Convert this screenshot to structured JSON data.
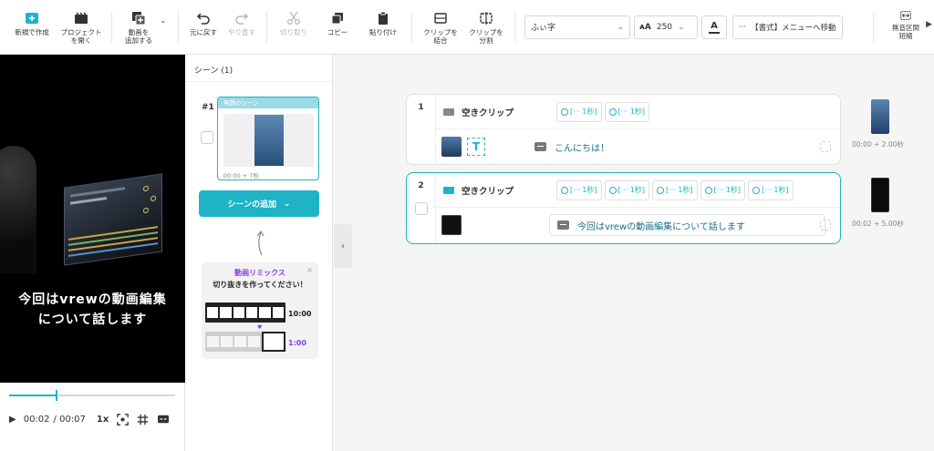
{
  "toolbar": {
    "new": "新規で作成",
    "open": "プロジェクト\nを開く",
    "add_video": "動画を\n追加する",
    "undo": "元に戻す",
    "redo": "やり直す",
    "cut": "切り取り",
    "copy": "コピー",
    "paste": "貼り付け",
    "merge": "クリップを\n結合",
    "split": "クリップを\n分割",
    "font": "ふぃ字",
    "font_size": "250",
    "size_icon": "ᴀA",
    "color_label": "A",
    "format_menu": "【書式】メニューへ移動",
    "more": "···",
    "silence": "無音区間\n短縮"
  },
  "player": {
    "caption_line1": "今回はvrewの動画編集",
    "caption_line2": "について話します",
    "current_time": "00:02",
    "total_time": "/ 00:07",
    "speed": "1x",
    "progress": 0.28
  },
  "scenes": {
    "title": "シーン (1)",
    "items": [
      {
        "num": "#1",
        "label": "無題のシーン",
        "duration": "00:00 + 7秒"
      }
    ],
    "add_label": "シーンの追加",
    "remix_title": "動画リミックス",
    "remix_sub": "切り抜きを作ってください！",
    "remix_time1": "10:00",
    "remix_time2": "1:00",
    "close": "×"
  },
  "clips": [
    {
      "num": "1",
      "name": "空きクリップ",
      "chips": [
        "[··· 1秒]",
        "[··· 1秒]"
      ],
      "text": "こんにちは！",
      "side_time": "00:00 + 2.00秒"
    },
    {
      "num": "2",
      "name": "空きクリップ",
      "chips": [
        "[··· 1秒]",
        "[··· 1秒]",
        "[··· 1秒]",
        "[··· 1秒]",
        "[··· 1秒]"
      ],
      "text": "今回はvrewの動画編集について話します",
      "side_time": "00:02 + 5.00秒"
    }
  ],
  "colors": {
    "accent": "#1fb3c8",
    "remix_purple": "#8a3fe0"
  }
}
